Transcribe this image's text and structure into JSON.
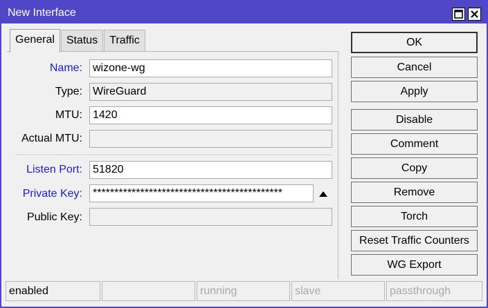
{
  "window": {
    "title": "New Interface",
    "maximize_icon": "maximize-icon",
    "close_icon": "close-icon"
  },
  "tabs": [
    {
      "label": "General",
      "active": true
    },
    {
      "label": "Status",
      "active": false
    },
    {
      "label": "Traffic",
      "active": false
    }
  ],
  "form": {
    "name": {
      "label": "Name:",
      "value": "wizone-wg"
    },
    "type": {
      "label": "Type:",
      "value": "WireGuard"
    },
    "mtu": {
      "label": "MTU:",
      "value": "1420"
    },
    "actual_mtu": {
      "label": "Actual MTU:",
      "value": ""
    },
    "listen_port": {
      "label": "Listen Port:",
      "value": "51820"
    },
    "private_key": {
      "label": "Private Key:",
      "value": "********************************************",
      "toggle_icon": "triangle-up-icon"
    },
    "public_key": {
      "label": "Public Key:",
      "value": ""
    }
  },
  "buttons": {
    "ok": "OK",
    "cancel": "Cancel",
    "apply": "Apply",
    "disable": "Disable",
    "comment": "Comment",
    "copy": "Copy",
    "remove": "Remove",
    "torch": "Torch",
    "reset_traffic_counters": "Reset Traffic Counters",
    "wg_export": "WG Export"
  },
  "status": {
    "enabled": "enabled",
    "blank": "",
    "running": "running",
    "slave": "slave",
    "passthrough": "passthrough"
  },
  "colors": {
    "titlebar": "#5046c8",
    "link_label": "#1b1bd8",
    "dim_status": "#a8a8a8"
  }
}
